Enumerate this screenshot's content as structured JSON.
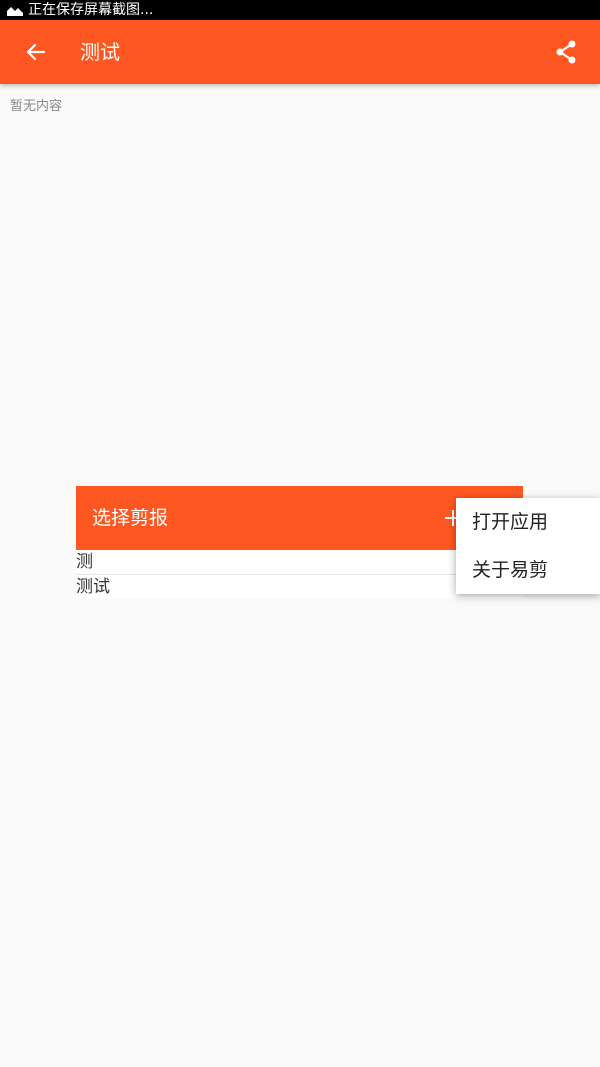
{
  "status_bar": {
    "text": "正在保存屏幕截图..."
  },
  "app_bar": {
    "title": "测试",
    "back_icon": "arrow-left-icon",
    "share_icon": "share-icon"
  },
  "content": {
    "empty_text": "暂无内容"
  },
  "clip_dialog": {
    "title": "选择剪报",
    "add_icon": "plus-icon",
    "items": [
      "测",
      "测试"
    ]
  },
  "popup_menu": {
    "items": [
      "打开应用",
      "关于易剪"
    ]
  },
  "colors": {
    "accent": "#ff5722",
    "status_bar": "#000000",
    "background": "#fafafa"
  }
}
